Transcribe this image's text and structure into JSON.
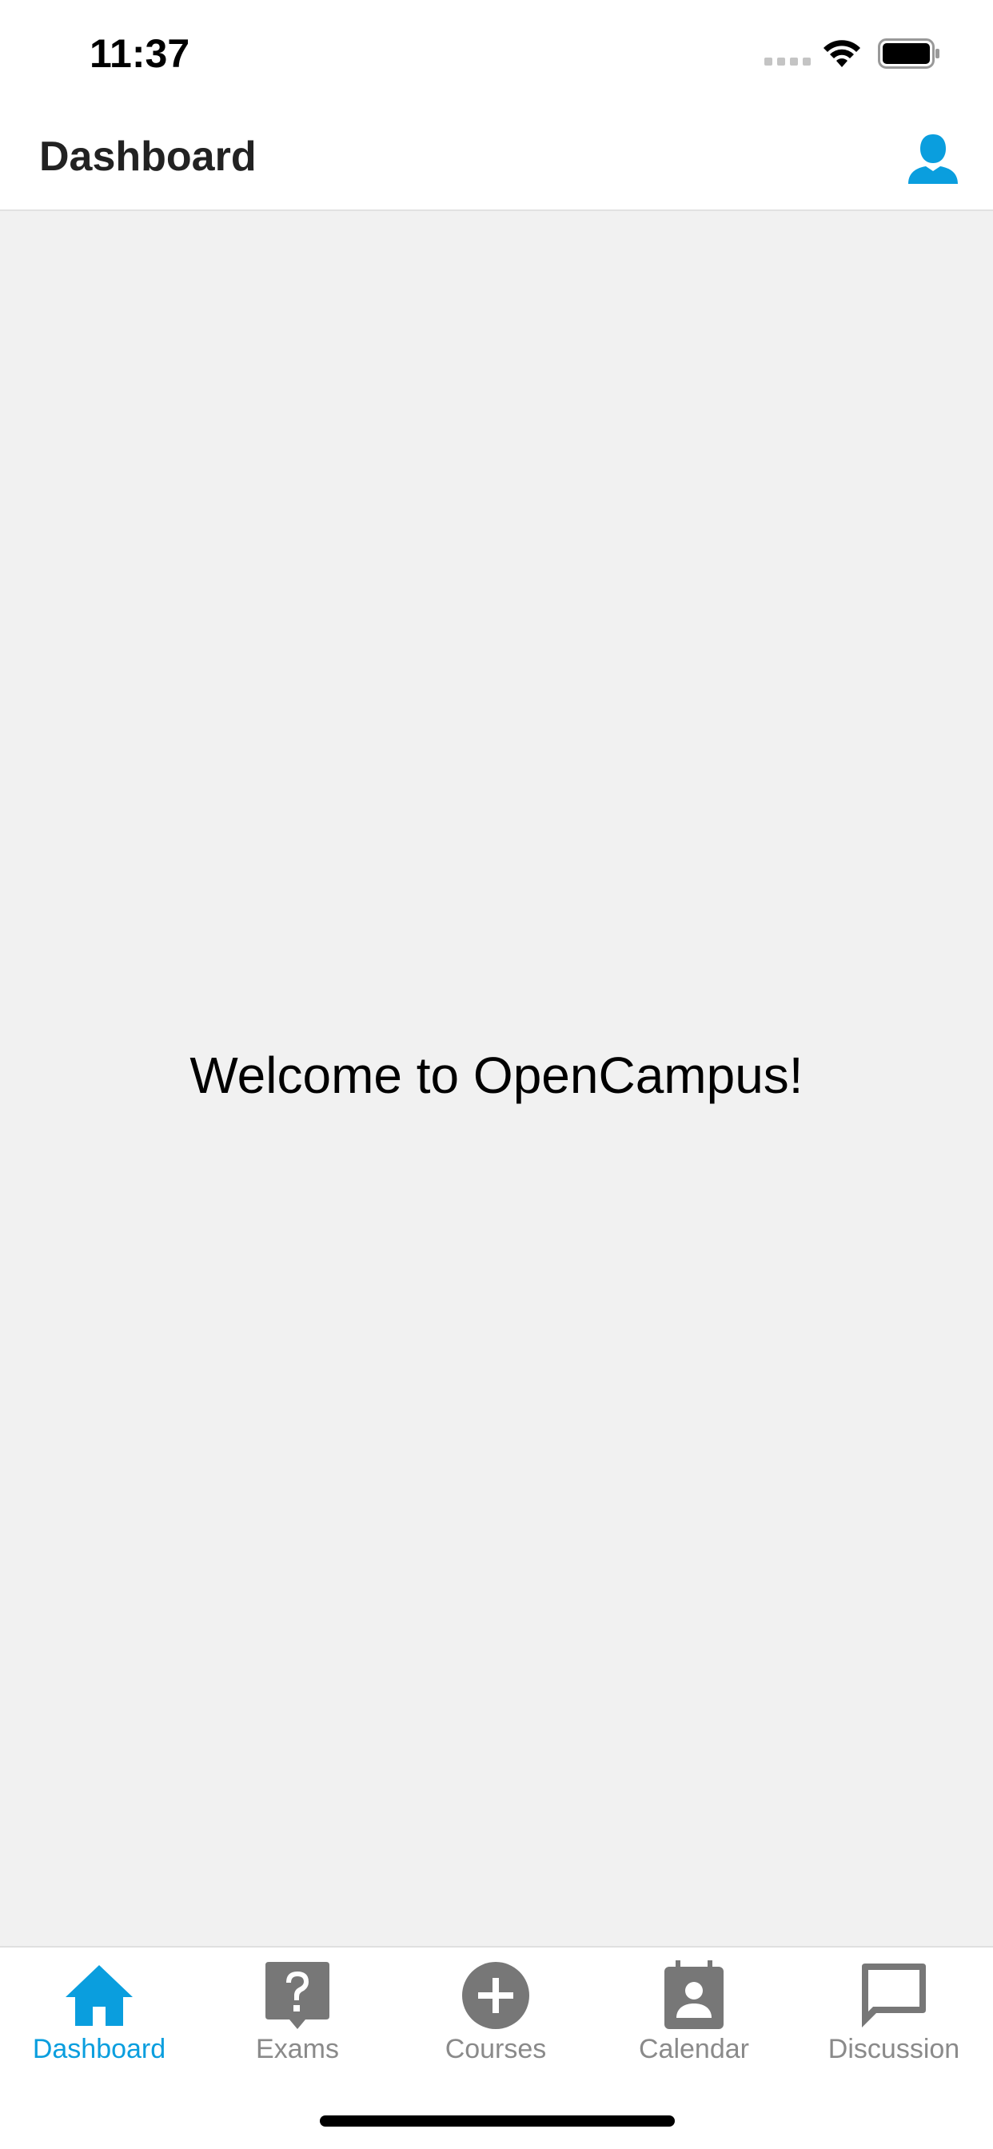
{
  "status_bar": {
    "time": "11:37"
  },
  "header": {
    "title": "Dashboard",
    "profile_icon": "person-icon"
  },
  "main": {
    "welcome": "Welcome to OpenCampus!"
  },
  "tab_bar": {
    "tabs": [
      {
        "label": "Dashboard",
        "icon": "home-icon",
        "active": true
      },
      {
        "label": "Exams",
        "icon": "question-bubble-icon",
        "active": false
      },
      {
        "label": "Courses",
        "icon": "plus-circle-icon",
        "active": false
      },
      {
        "label": "Calendar",
        "icon": "contact-calendar-icon",
        "active": false
      },
      {
        "label": "Discussion",
        "icon": "chat-bubble-icon",
        "active": false
      }
    ]
  },
  "colors": {
    "accent": "#0a9ede",
    "inactive": "#8a8a8a",
    "background": "#f1f1f1",
    "icon_inactive": "#777777"
  }
}
